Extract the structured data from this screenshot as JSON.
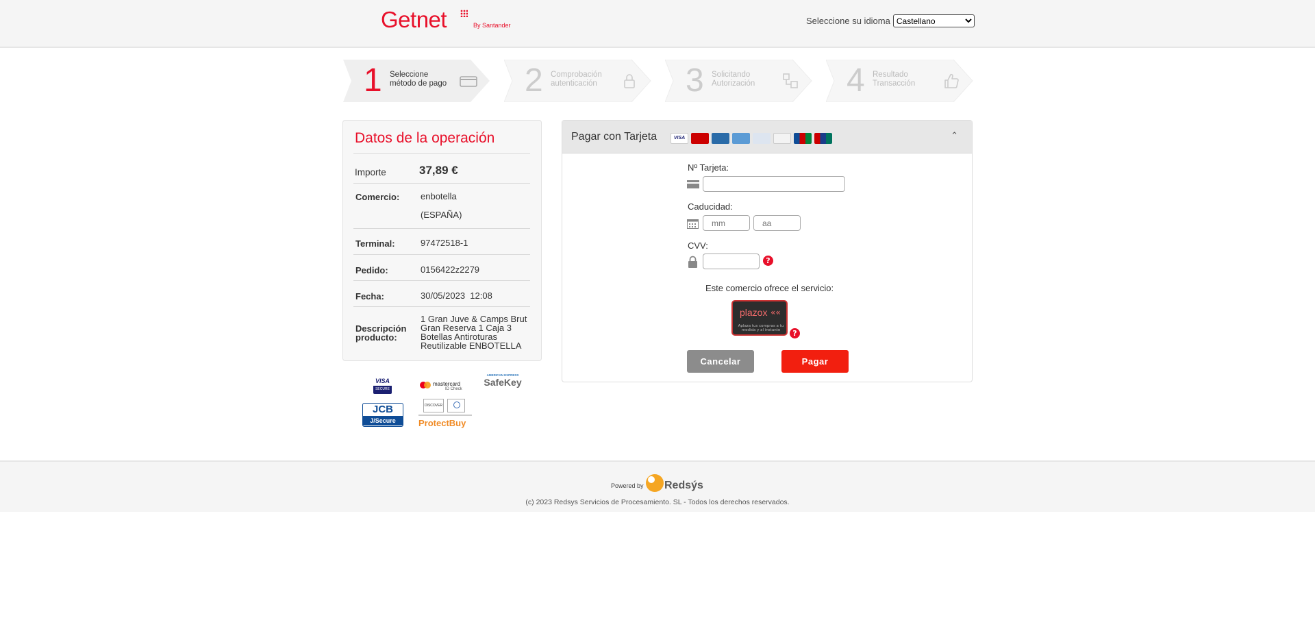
{
  "header": {
    "logo_text": "Getnet",
    "logo_by": "By Santander",
    "language_label": "Seleccione su idioma",
    "language_selected": "Castellano"
  },
  "steps": [
    {
      "number": "1",
      "line1": "Seleccione",
      "line2": "método de pago",
      "icon": "card-icon",
      "active": true
    },
    {
      "number": "2",
      "line1": "Comprobación",
      "line2": "autenticación",
      "icon": "lock-icon",
      "active": false
    },
    {
      "number": "3",
      "line1": "Solicitando",
      "line2": "Autorización",
      "icon": "transfer-icon",
      "active": false
    },
    {
      "number": "4",
      "line1": "Resultado",
      "line2": "Transacción",
      "icon": "thumbs-up-icon",
      "active": false
    }
  ],
  "operation": {
    "title": "Datos de la operación",
    "amount_label": "Importe",
    "amount_value": "37,89 €",
    "merchant_label": "Comercio:",
    "merchant_line1": "enbotella",
    "merchant_line2": "(ESPAÑA)",
    "terminal_label": "Terminal:",
    "terminal_value": "97472518-1",
    "order_label": "Pedido:",
    "order_value": "0156422z2279",
    "date_label": "Fecha:",
    "date_value": "30/05/2023  12:08",
    "description_label": "Descripción producto:",
    "description_value": "1 Gran Juve & Camps Brut Gran Reserva 1 Caja 3 Botellas Antiroturas Reutilizable ENBOTELLA"
  },
  "security_brands": {
    "visa": "VISA",
    "visa_sub": "SECURE",
    "mastercard": "mastercard",
    "mastercard_sub": "ID Check",
    "amex_top": "AMERICAN EXPRESS",
    "safekey": "SafeKey",
    "jcb": "JCB",
    "jcb_sub": "J/Secure",
    "discover": "DISCOVER",
    "protectbuy": "ProtectBuy"
  },
  "payment": {
    "title": "Pagar con Tarjeta",
    "card_number_label": "Nº Tarjeta:",
    "card_number_value": "",
    "expiry_label": "Caducidad:",
    "month_placeholder": "mm",
    "year_placeholder": "aa",
    "cvv_label": "CVV:",
    "cvv_value": "",
    "service_text": "Este comercio ofrece el servicio:",
    "plazo_name": "plazox",
    "plazo_tagline": "Aplaza tus compras a tu medida y al instante",
    "cancel_label": "Cancelar",
    "pay_label": "Pagar",
    "help": "?"
  },
  "footer": {
    "powered_by": "Powered by",
    "brand": "Redsýs",
    "copyright": "(c) 2023 Redsys Servicios de Procesamiento. SL - Todos los derechos reservados."
  },
  "colors": {
    "brand_red": "#e8102a",
    "pay_button": "#f21f0f",
    "cancel_button": "#8c8c8c"
  }
}
